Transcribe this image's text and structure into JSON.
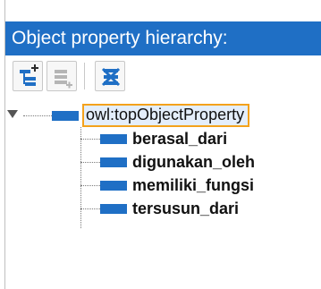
{
  "panel": {
    "title": "Object property hierarchy:"
  },
  "toolbar": {
    "buttons": [
      {
        "name": "add-subproperty-button",
        "icon": "add-subproperty-icon",
        "enabled": true
      },
      {
        "name": "add-sibling-property-button",
        "icon": "add-sibling-property-icon",
        "enabled": false
      },
      {
        "name": "delete-property-button",
        "icon": "delete-property-icon",
        "enabled": true
      }
    ]
  },
  "tree": {
    "root": {
      "label": "owl:topObjectProperty",
      "expanded": true,
      "selected": true
    },
    "children": [
      {
        "label": "berasal_dari"
      },
      {
        "label": "digunakan_oleh"
      },
      {
        "label": "memiliki_fungsi"
      },
      {
        "label": "tersusun_dari"
      }
    ]
  },
  "colors": {
    "header_bg": "#1f6fc5",
    "swatch": "#1f6fc5",
    "selection_border": "#f4a21c"
  }
}
